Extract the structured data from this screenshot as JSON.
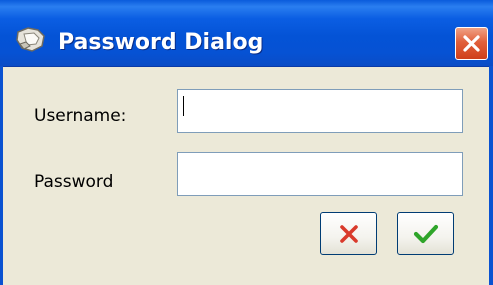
{
  "window": {
    "title": "Password Dialog",
    "app_icon": "hand-key-icon",
    "close_icon": "close-icon"
  },
  "form": {
    "username_label": "Username:",
    "username_value": "",
    "password_label": "Password",
    "password_value": ""
  },
  "buttons": {
    "cancel_icon": "red-x-icon",
    "ok_icon": "green-check-icon"
  },
  "colors": {
    "titlebar": "#0453d6",
    "dialog_bg": "#ece9d8",
    "close_button": "#e1603b",
    "cancel_icon": "#d93a2b",
    "ok_icon": "#2fa52a"
  }
}
